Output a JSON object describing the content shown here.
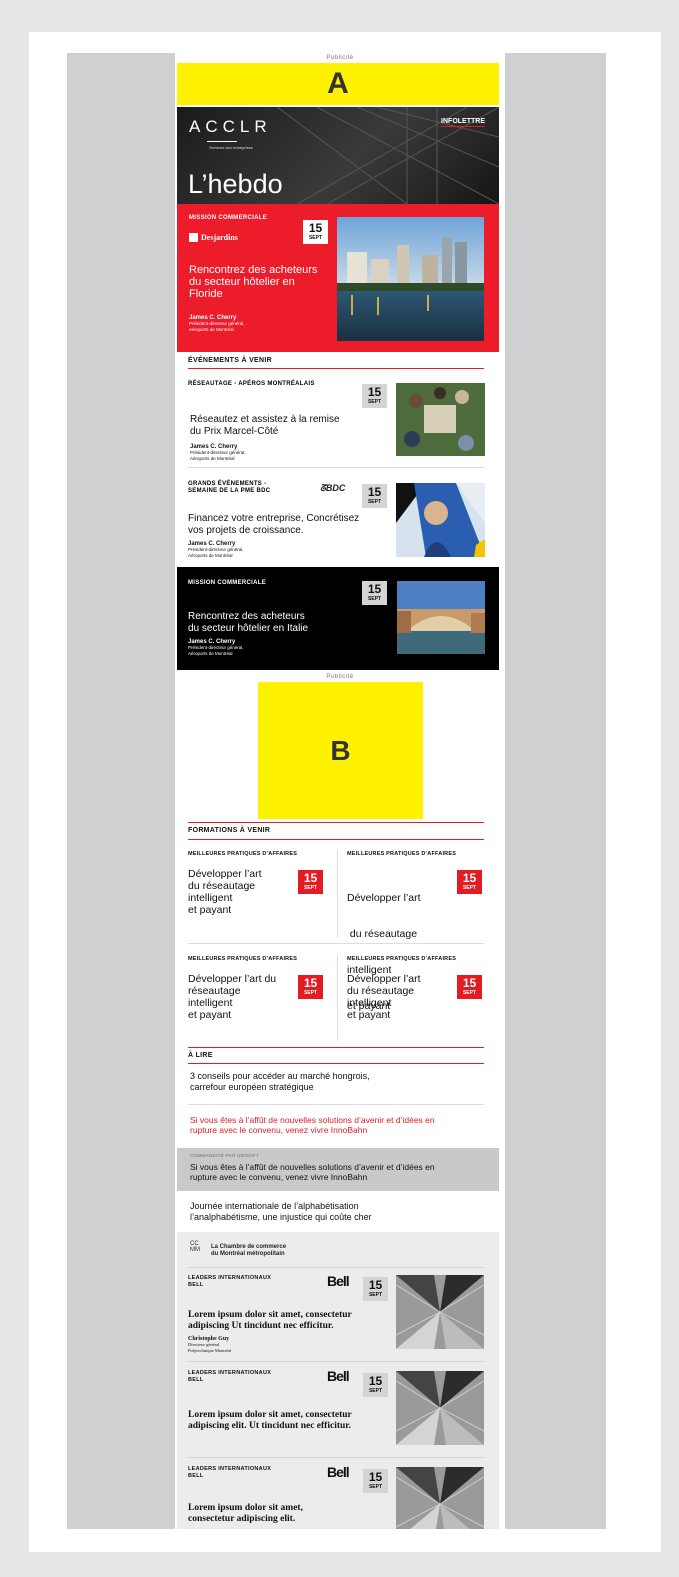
{
  "top_ad": {
    "label": "Publicité",
    "placeholder": "A"
  },
  "header": {
    "logo": "ACCLR",
    "tagline": "Services aux entreprises",
    "infolettre": "INFOLETTRE",
    "title": "L’hebdo"
  },
  "featured": {
    "tag": "MISSION COMMERCIALE",
    "sponsor": "Desjardins",
    "date_day": "15",
    "date_month": "SEPT",
    "title_lines": [
      "Rencontrez des acheteurs",
      "du secteur hôtelier en",
      "Floride"
    ],
    "person": "James C. Cherry",
    "role1": "Président-directeur général,",
    "role2": "Aéroports de Montréal"
  },
  "events": {
    "section_title": "ÉVÉNEMENTS À VENIR",
    "items": [
      {
        "tag1": "RÉSEAUTAGE - APÉROS MONTRÉALAIS",
        "tag2": "",
        "date_day": "15",
        "date_month": "SEPT",
        "title_lines": [
          "Réseautez et assistez à la remise",
          "du Prix Marcel-Côté"
        ],
        "person": "James C. Cherry",
        "role1": "Président-directeur général,",
        "role2": "Aéroports de Montréal"
      },
      {
        "tag1": "GRANDS ÉVÉNEMENTS -",
        "tag2": "SEMAINE DE LA PME BDC",
        "sponsor": "BDC",
        "date_day": "15",
        "date_month": "SEPT",
        "title_lines": [
          "Financez votre entreprise, Concrétisez",
          "vos projets de croissance."
        ],
        "person": "James C. Cherry",
        "role1": "Président-directeur général,",
        "role2": "Aéroports de Montréal"
      },
      {
        "tag1": "MISSION COMMERCIALE",
        "date_day": "15",
        "date_month": "SEPT",
        "title_lines": [
          "Rencontrez des acheteurs",
          "du secteur hôtelier en Italie"
        ],
        "person": "James C. Cherry",
        "role1": "Président-directeur général,",
        "role2": "Aéroports de Montréal"
      }
    ]
  },
  "middle_ad": {
    "label": "Publicité",
    "placeholder": "B"
  },
  "formations": {
    "section_title": "FORMATIONS À VENIR",
    "items": [
      {
        "tag": "MEILLEURES PRATIQUES D’AFFAIRES",
        "lines": [
          "Développer l’art",
          "du réseautage",
          "intelligent",
          "et payant"
        ],
        "date_day": "15",
        "date_month": "SEPT"
      },
      {
        "tag": "MEILLEURES PRATIQUES D’AFFAIRES",
        "lines": [
          "Développer l’art",
          " du réseautage",
          "intelligent",
          "et payant"
        ],
        "date_day": "15",
        "date_month": "SEPT"
      },
      {
        "tag": "MEILLEURES PRATIQUES D’AFFAIRES",
        "lines": [
          "Développer l’art du",
          "réseautage",
          "intelligent",
          "et payant"
        ],
        "date_day": "15",
        "date_month": "SEPT"
      },
      {
        "tag": "MEILLEURES PRATIQUES D’AFFAIRES",
        "lines": [
          "Développer l’art",
          "du réseautage",
          "intelligent",
          "et payant"
        ],
        "date_day": "15",
        "date_month": "SEPT"
      }
    ]
  },
  "a_lire": {
    "section_title": "À LIRE",
    "article1_lines": [
      "3 conseils pour accéder au marché hongrois,",
      "carrefour européen stratégique"
    ],
    "promo_lines": [
      "Si vous êtes à l’affût de nouvelles solutions d’avenir et d’idées en",
      "rupture avec le convenu, venez vivre InnoBahn"
    ],
    "sponsored_label": "COMMANDITÉ PAR UBISOFT",
    "sponsored_lines": [
      "Si vous êtes à l’affût de nouvelles solutions d’avenir et d’idées en",
      "rupture avec le convenu, venez vivre InnoBahn"
    ],
    "article2_lines": [
      "Journée internationale de l’alphabétisation",
      "l’analphabétisme, une injustice qui coûte cher"
    ]
  },
  "chamber": {
    "logo_mark": "CC\nMM",
    "name_line1": "La Chambre de commerce",
    "name_line2": "du Montréal métropolitain",
    "items": [
      {
        "tag1": "LEADERS INTERNATIONAUX",
        "tag2": "BELL",
        "sponsor": "Bell",
        "date_day": "15",
        "date_month": "SEPT",
        "title_lines": [
          "Lorem ipsum dolor sit amet, consectetur",
          "adipiscing Ut tincidunt nec efficitur."
        ],
        "person": "Christophe Guy",
        "role1": "Directeur général",
        "role2": "Polytechnique Montréal"
      },
      {
        "tag1": "LEADERS INTERNATIONAUX",
        "tag2": "BELL",
        "sponsor": "Bell",
        "date_day": "15",
        "date_month": "SEPT",
        "title_lines": [
          "Lorem ipsum dolor sit amet, consectetur",
          "adipiscing elit. Ut tincidunt nec efficitur."
        ]
      },
      {
        "tag1": "LEADERS INTERNATIONAUX",
        "tag2": "BELL",
        "sponsor": "Bell",
        "date_day": "15",
        "date_month": "SEPT",
        "title_lines": [
          "Lorem ipsum dolor sit amet,",
          "consectetur adipiscing elit."
        ]
      }
    ]
  },
  "colors": {
    "accent_red": "#e31b23",
    "ad_yellow": "#fff200",
    "header_dark": "#1f1f1f"
  }
}
